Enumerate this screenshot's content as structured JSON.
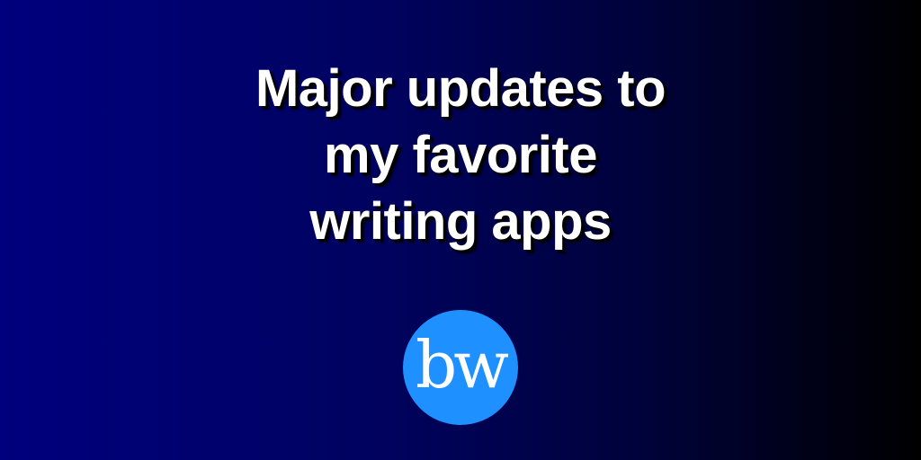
{
  "banner": {
    "background_colors": [
      "#00007e",
      "#000000"
    ],
    "headline": {
      "lines": [
        "Major updates to",
        "my favorite",
        "writing apps"
      ]
    },
    "logo": {
      "text": "bw",
      "circle_color": "#1e90ff",
      "text_color": "#ffffff"
    }
  }
}
